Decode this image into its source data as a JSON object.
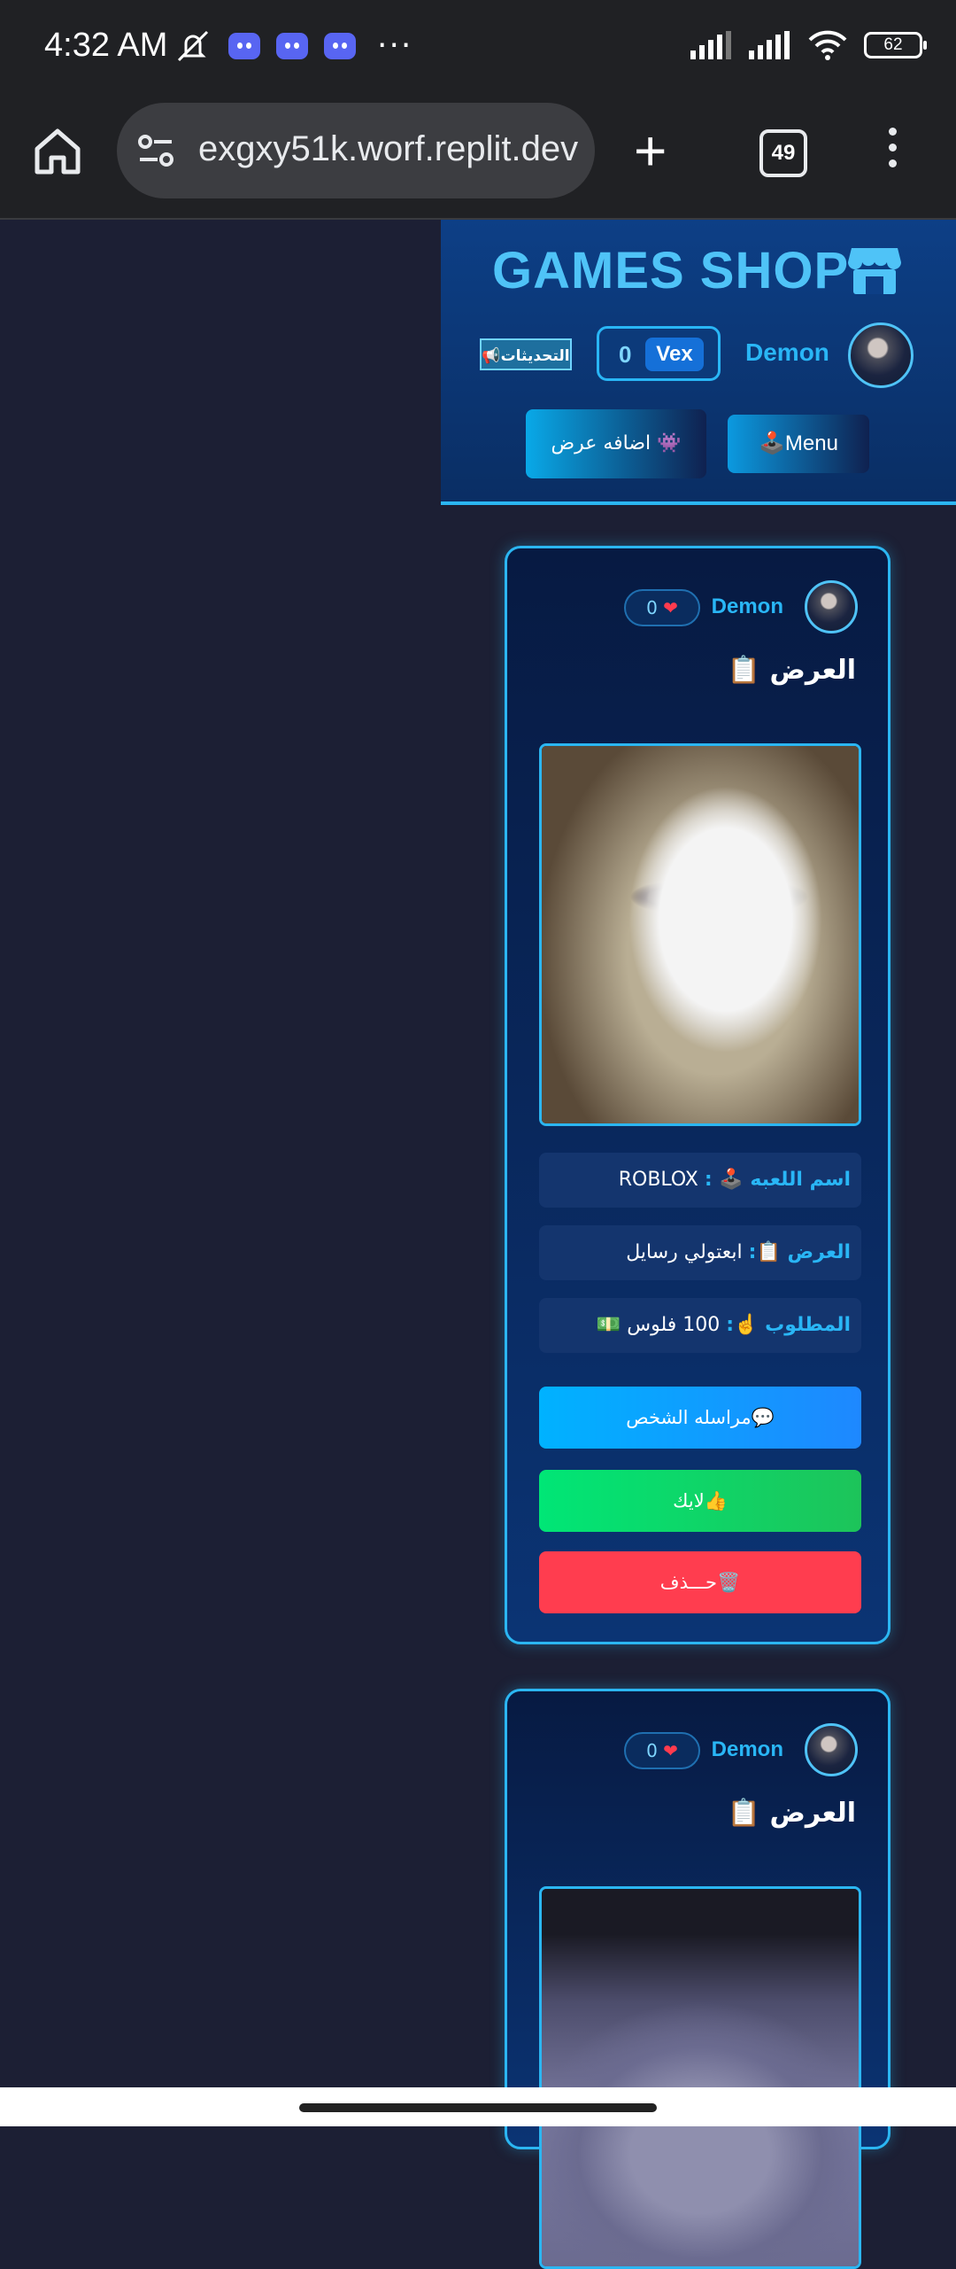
{
  "status_bar": {
    "time": "4:32 AM",
    "battery": "62"
  },
  "browser": {
    "url": "exgxy51k.worf.replit.dev",
    "tab_count": "49"
  },
  "header": {
    "title": "GAMES SHOP",
    "updates_label": "📢التحديثات",
    "balance": "0",
    "currency": "Vex",
    "username": "Demon",
    "add_offer_label": "اضافه عرض 👾",
    "menu_label": "🕹️Menu"
  },
  "offers": [
    {
      "username": "Demon",
      "likes": "0",
      "title": "العرض 📋",
      "game_label": "اسم اللعبه 🕹️ :",
      "game_value": "ROBLOX",
      "offer_label": "العرض 📋:",
      "offer_value": "ابعتولي رسايل",
      "wanted_label": "المطلوب ☝️:",
      "wanted_value": "100 فلوس 💵",
      "message_label": "مراسله الشخص💬",
      "like_label": "لايك👍",
      "delete_label": "حـــذف🗑️"
    },
    {
      "username": "Demon",
      "likes": "0",
      "title": "العرض 📋"
    }
  ],
  "colors": {
    "accent": "#29b6f6",
    "like": "#00e676",
    "delete": "#ff3d4f"
  }
}
